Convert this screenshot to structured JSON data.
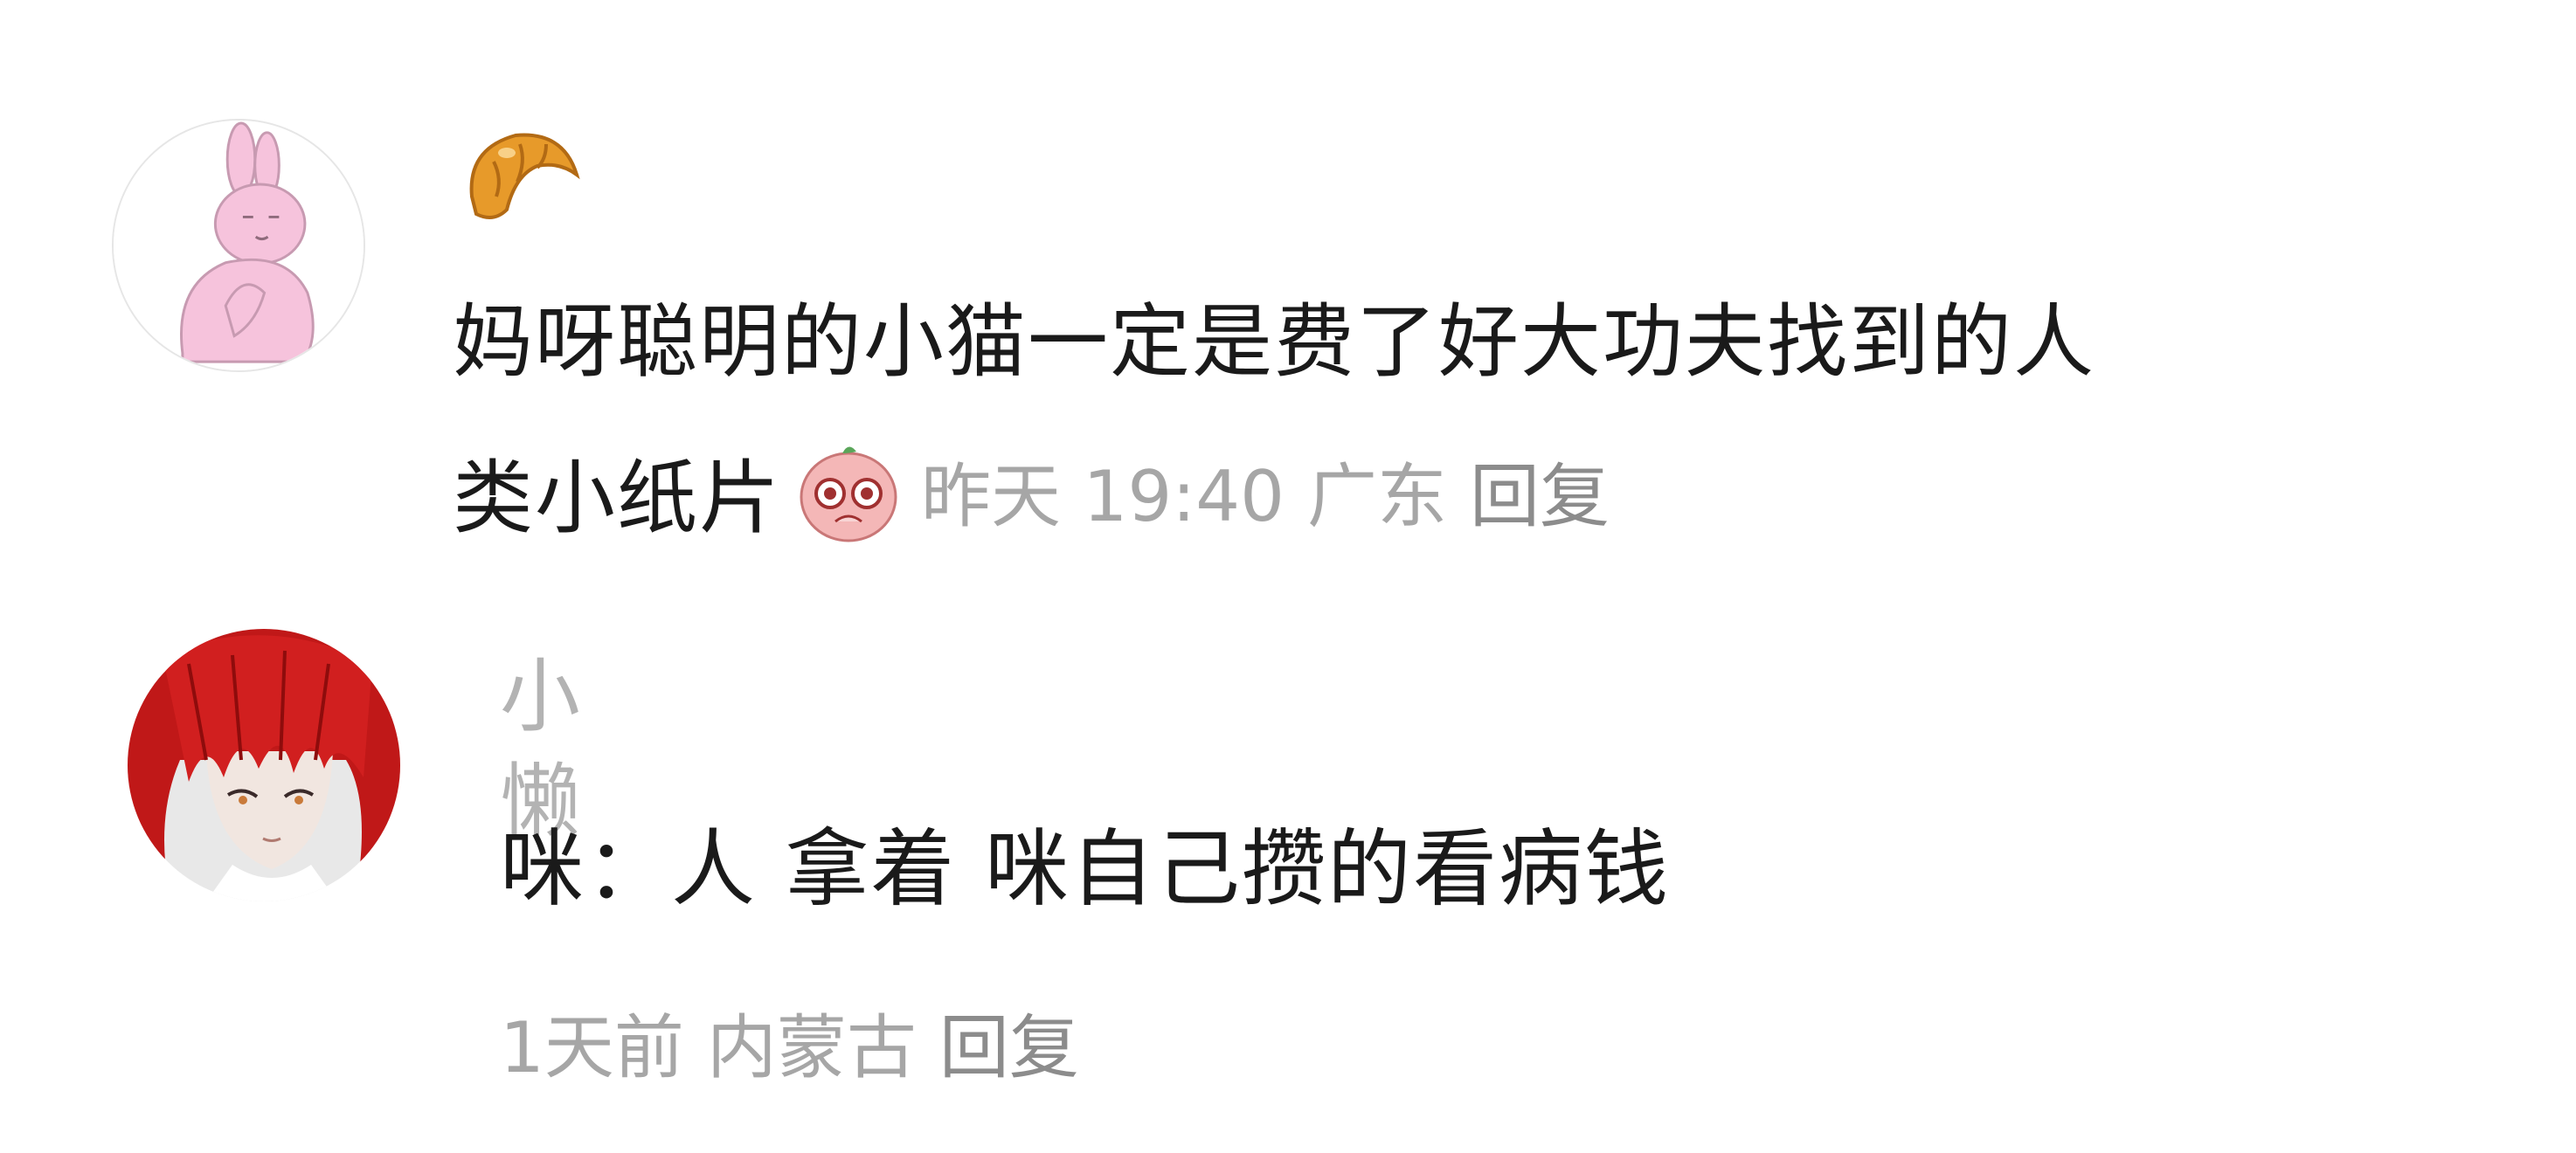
{
  "comments": [
    {
      "username_icon": "croissant-emoji",
      "avatar_icon": "pink-rabbit-praying-avatar",
      "text_line1": "妈呀聪明的小猫一定是费了好大功夫找到的人",
      "text_line2": "类小纸片",
      "sticker_icon": "pleading-face-sticker",
      "time": "昨天 19:40",
      "location": "广东",
      "reply_label": "回复"
    },
    {
      "username": "小懒",
      "avatar_icon": "red-hair-anime-avatar",
      "text": "咪：人 拿着 咪自己攒的看病钱",
      "time": "1天前",
      "location": "内蒙古",
      "reply_label": "回复"
    }
  ],
  "colors": {
    "text": "#1a1a1a",
    "meta": "#a6a6a6",
    "username": "#b3b3b3"
  }
}
